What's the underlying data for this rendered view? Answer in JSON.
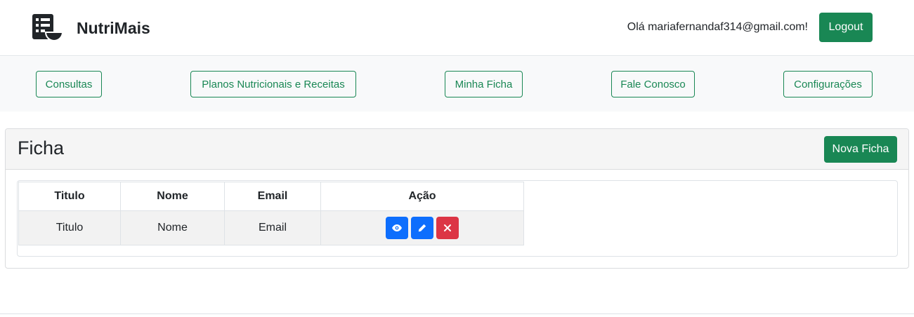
{
  "header": {
    "brand": "NutriMais",
    "logo_icon": "menu-bowl-icon",
    "greeting": "Olá mariafernandaf314@gmail.com!",
    "logout_label": "Logout"
  },
  "nav": {
    "items": [
      {
        "label": "Consultas"
      },
      {
        "label": "Planos Nutricionais e Receitas"
      },
      {
        "label": "Minha Ficha"
      },
      {
        "label": "Fale Conosco"
      },
      {
        "label": "Configurações"
      }
    ]
  },
  "card": {
    "title": "Ficha",
    "new_button_label": "Nova Ficha"
  },
  "table": {
    "headers": [
      "Titulo",
      "Nome",
      "Email",
      "Ação"
    ],
    "rows": [
      {
        "titulo": "Titulo",
        "nome": "Nome",
        "email": "Email"
      }
    ],
    "actions": [
      "eye-icon",
      "pencil-icon",
      "close-icon"
    ]
  },
  "colors": {
    "primary_green": "#198754",
    "action_blue": "#0d6efd",
    "action_red": "#dc3545"
  }
}
